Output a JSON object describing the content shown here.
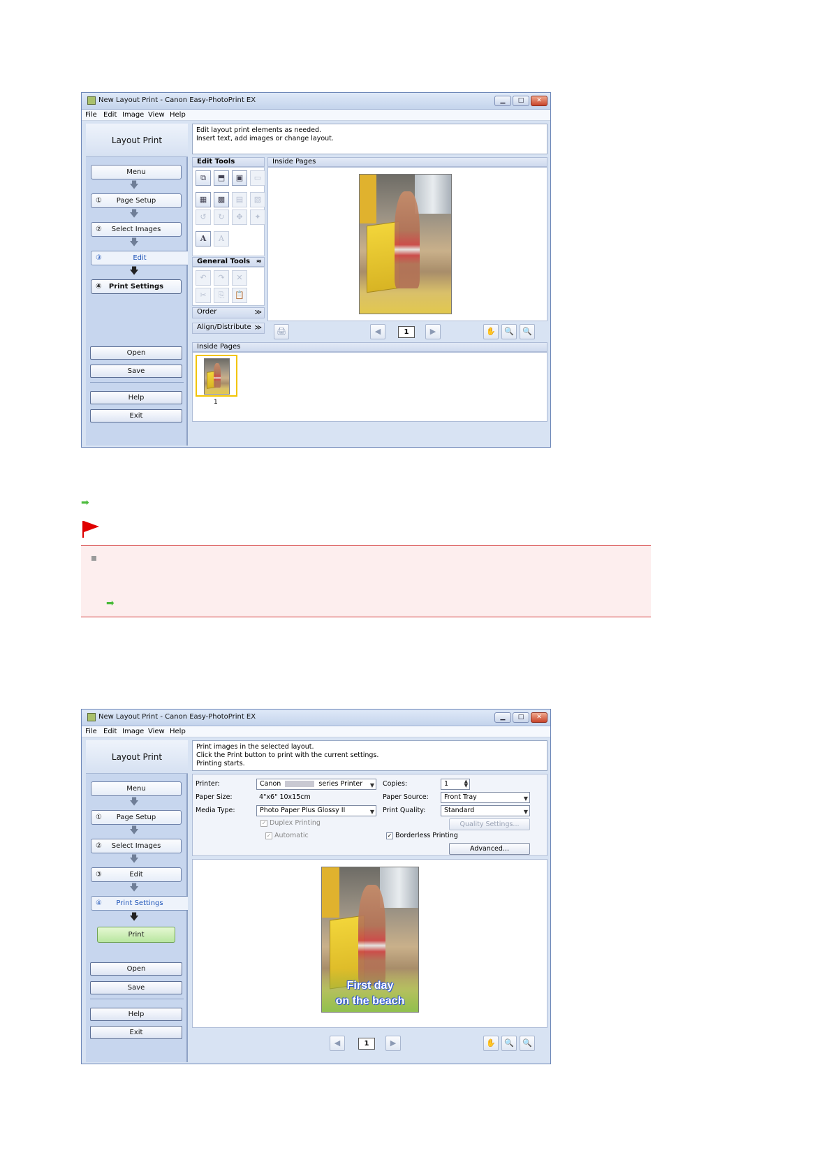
{
  "window1": {
    "title": "New Layout Print - Canon Easy-PhotoPrint EX",
    "menu": [
      "File",
      "Edit",
      "Image",
      "View",
      "Help"
    ],
    "side_title": "Layout Print",
    "steps": {
      "menu": "Menu",
      "page_setup": "Page Setup",
      "select_images": "Select Images",
      "edit": "Edit",
      "print_settings": "Print Settings"
    },
    "step_nums": {
      "s1": "①",
      "s2": "②",
      "s3": "③",
      "s4": "④"
    },
    "buttons": {
      "open": "Open",
      "save": "Save",
      "help": "Help",
      "exit": "Exit"
    },
    "message_line1": "Edit layout print elements as needed.",
    "message_line2": "Insert text, add images or change layout.",
    "edit_tools_label": "Edit Tools",
    "general_tools_label": "General Tools",
    "order_label": "Order",
    "align_label": "Align/Distribute",
    "preview_header": "Inside Pages",
    "thumbs_header": "Inside Pages",
    "page_number": "1",
    "thumb_label": "1"
  },
  "window2": {
    "title": "New Layout Print - Canon Easy-PhotoPrint EX",
    "menu": [
      "File",
      "Edit",
      "Image",
      "View",
      "Help"
    ],
    "side_title": "Layout Print",
    "steps": {
      "menu": "Menu",
      "page_setup": "Page Setup",
      "select_images": "Select Images",
      "edit": "Edit",
      "print_settings": "Print Settings",
      "print": "Print"
    },
    "step_nums": {
      "s1": "①",
      "s2": "②",
      "s3": "③",
      "s4": "④"
    },
    "buttons": {
      "open": "Open",
      "save": "Save",
      "help": "Help",
      "exit": "Exit"
    },
    "message_line1": "Print images in the selected layout.",
    "message_line2": "Click the Print button to print with the current settings.",
    "message_line3": "Printing starts.",
    "settings": {
      "printer_label": "Printer:",
      "printer_value_prefix": "Canon",
      "printer_value_suffix": "series Printer",
      "paper_size_label": "Paper Size:",
      "paper_size_value": "4\"x6\" 10x15cm",
      "media_type_label": "Media Type:",
      "media_type_value": "Photo Paper Plus Glossy II",
      "duplex_label": "Duplex Printing",
      "automatic_label": "Automatic",
      "copies_label": "Copies:",
      "copies_value": "1",
      "paper_source_label": "Paper Source:",
      "paper_source_value": "Front Tray",
      "print_quality_label": "Print Quality:",
      "print_quality_value": "Standard",
      "quality_settings_label": "Quality Settings...",
      "borderless_label": "Borderless Printing",
      "advanced_label": "Advanced..."
    },
    "photo_caption_line1": "First day",
    "photo_caption_line2": "on the beach",
    "page_number": "1"
  },
  "colors": {
    "accent_blue": "#1f55b8",
    "print_green": "#b9e6a0",
    "note_bg": "#fdeeee",
    "note_border": "#d43a3a",
    "link_arrow": "#4cbb3c"
  }
}
